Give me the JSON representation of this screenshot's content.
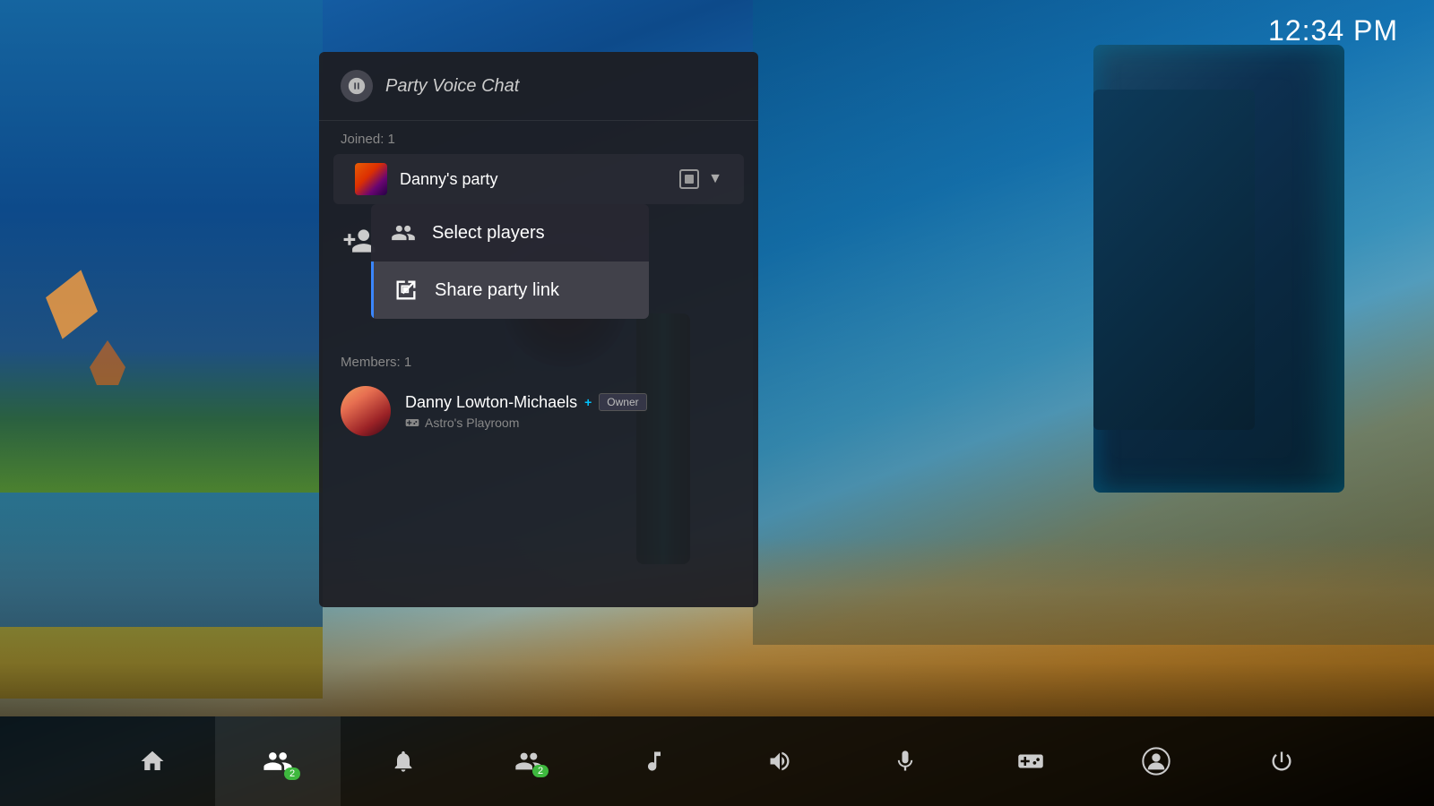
{
  "clock": {
    "time": "12:34 PM"
  },
  "panel": {
    "header": {
      "icon": "🎮",
      "title": "Party Voice Chat"
    },
    "joined_label": "Joined: 1",
    "party": {
      "name": "Danny's party"
    },
    "add_player": {
      "dropdown": {
        "items": [
          {
            "id": "select-players",
            "label": "Select players",
            "icon": "people"
          },
          {
            "id": "share-party-link",
            "label": "Share party link",
            "icon": "qr",
            "active": true
          }
        ]
      }
    },
    "members_label": "Members: 1",
    "members": [
      {
        "name": "Danny Lowton-Michaels",
        "ps_plus": true,
        "is_owner": true,
        "owner_label": "Owner",
        "game": "Astro's Playroom"
      }
    ]
  },
  "bottom_nav": {
    "items": [
      {
        "id": "home",
        "icon": "home",
        "label": "Home"
      },
      {
        "id": "party",
        "icon": "party",
        "label": "Party",
        "active": true
      },
      {
        "id": "notifications",
        "icon": "bell",
        "label": "Notifications"
      },
      {
        "id": "friends",
        "icon": "friends",
        "label": "Friends",
        "badge": "2"
      },
      {
        "id": "music",
        "icon": "music",
        "label": "Music"
      },
      {
        "id": "audio",
        "icon": "audio",
        "label": "Audio"
      },
      {
        "id": "mic",
        "icon": "mic",
        "label": "Mic"
      },
      {
        "id": "gamepad",
        "icon": "gamepad",
        "label": "Gamepad"
      },
      {
        "id": "profile",
        "icon": "profile",
        "label": "Profile"
      },
      {
        "id": "power",
        "icon": "power",
        "label": "Power"
      }
    ]
  }
}
